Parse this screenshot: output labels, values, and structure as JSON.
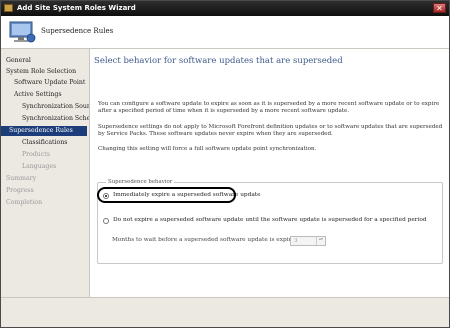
{
  "window": {
    "title": "Add Site System Roles Wizard",
    "close_glyph": "✕"
  },
  "header": {
    "title": "Supersedence Rules"
  },
  "sidebar": {
    "items": [
      {
        "label": "General"
      },
      {
        "label": "System Role Selection"
      },
      {
        "label": "Software Update Point"
      },
      {
        "label": "Active Settings"
      },
      {
        "label": "Synchronization Source"
      },
      {
        "label": "Synchronization Schedule"
      },
      {
        "label": "Supersedence Rules"
      },
      {
        "label": "Classifications"
      },
      {
        "label": "Products"
      },
      {
        "label": "Languages"
      },
      {
        "label": "Summary"
      },
      {
        "label": "Progress"
      },
      {
        "label": "Completion"
      }
    ]
  },
  "main": {
    "heading": "Select behavior for software updates that are superseded",
    "para1": "You can configure a software update to expire as soon as it is superseded by a more recent software update or to expire after a specified period of time when it is superseded by a more recent software update.",
    "para2": "Supersedence settings do not apply to Microsoft Forefront definition updates or to software updates that are superseded by Service Packs. These software updates never expire when they are superseded.",
    "para3": "Changing this setting will force a full software update point synchronization.",
    "group_label": "Supersedence behavior",
    "option1": "Immediately expire a superseded software update",
    "option2": "Do not expire a superseded software update until the software update is superseded for a specified period",
    "months_label": "Months to wait before a superseded software update is expired:",
    "months_value": "3",
    "spin_arrows": "▴▾"
  }
}
